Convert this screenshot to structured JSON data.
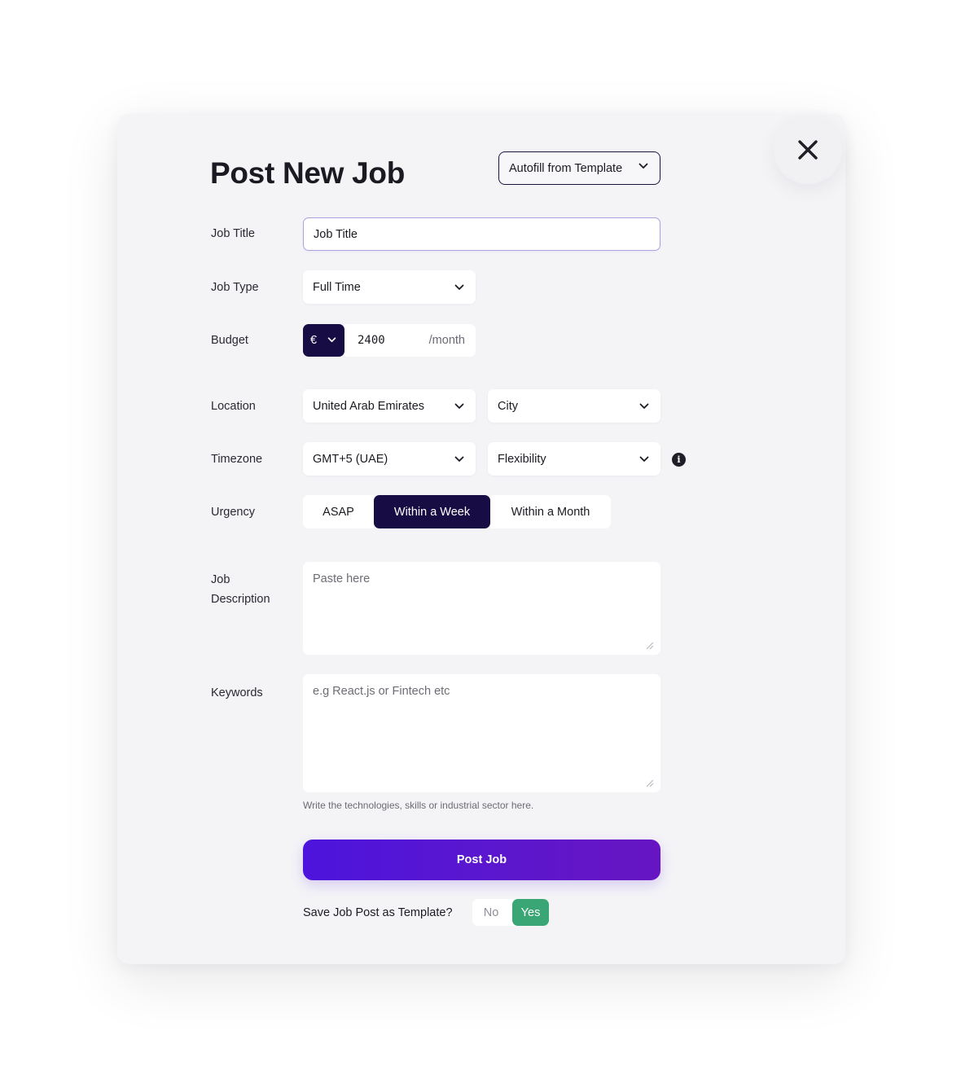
{
  "modal": {
    "title": "Post New Job",
    "autofill_label": "Autofill from Template"
  },
  "fields": {
    "job_title": {
      "label": "Job Title",
      "value": "Job Title"
    },
    "job_type": {
      "label": "Job Type",
      "value": "Full Time"
    },
    "budget": {
      "label": "Budget",
      "currency": "€",
      "amount": "2400",
      "unit": "/month"
    },
    "location": {
      "label": "Location",
      "country": "United Arab Emirates",
      "city": "City"
    },
    "timezone": {
      "label": "Timezone",
      "value": "GMT+5 (UAE)",
      "flexibility": "Flexibility"
    },
    "urgency": {
      "label": "Urgency",
      "options": [
        "ASAP",
        "Within a Week",
        "Within a Month"
      ],
      "selected": "Within a Week"
    },
    "job_description": {
      "label_line1": "Job",
      "label_line2": "Description",
      "placeholder": "Paste here"
    },
    "keywords": {
      "label": "Keywords",
      "placeholder": "e.g React.js or Fintech etc",
      "helper": "Write the technologies, skills or industrial sector here."
    }
  },
  "actions": {
    "post_label": "Post Job",
    "save_template_question": "Save Job Post as Template?",
    "no_label": "No",
    "yes_label": "Yes",
    "save_template_selected": "Yes"
  },
  "icons": {
    "close": "close-icon",
    "dropdown": "chevron-down-icon",
    "info": "info-icon",
    "resize": "resize-handle-icon"
  },
  "colors": {
    "primary_dark": "#170c44",
    "gradient_start": "#4d14dd",
    "gradient_end": "#6715c2",
    "success": "#3aa675",
    "focus_border": "#a9a3e6"
  }
}
